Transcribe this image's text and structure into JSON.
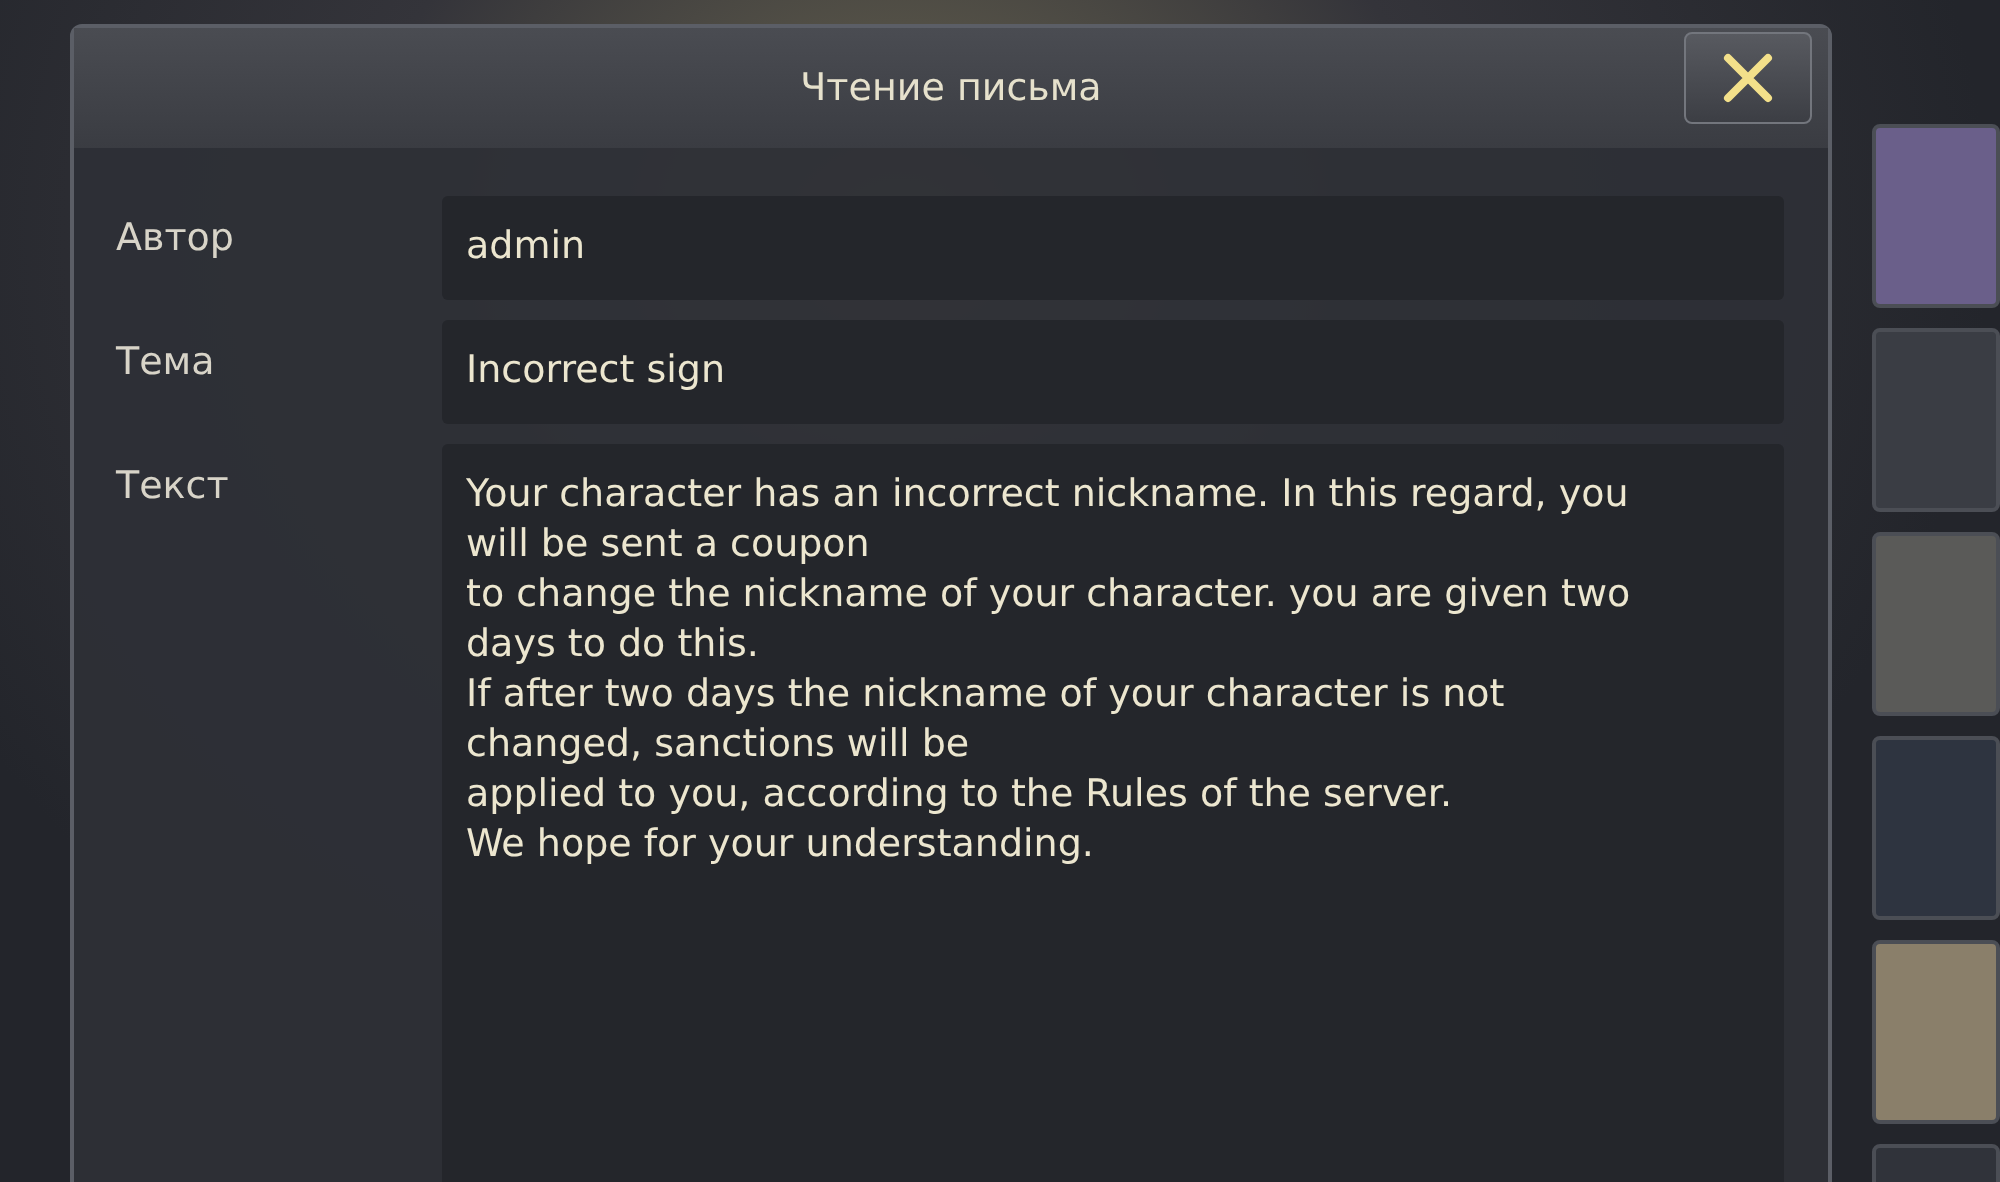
{
  "dialog": {
    "title": "Чтение письма",
    "fields": [
      {
        "label": "Автор",
        "value": "admin"
      },
      {
        "label": "Тема",
        "value": "Incorrect sign"
      }
    ],
    "message": {
      "label": "Текст",
      "lines": [
        "Your character has an incorrect nickname. In this regard, you",
        "will be sent a coupon",
        "to change the nickname of your character. you are given two",
        "days to do this.",
        "If after two days the nickname of your character is not",
        "changed, sanctions will be",
        "applied to you, according to the Rules of the server.",
        "We hope for your understanding."
      ]
    }
  }
}
